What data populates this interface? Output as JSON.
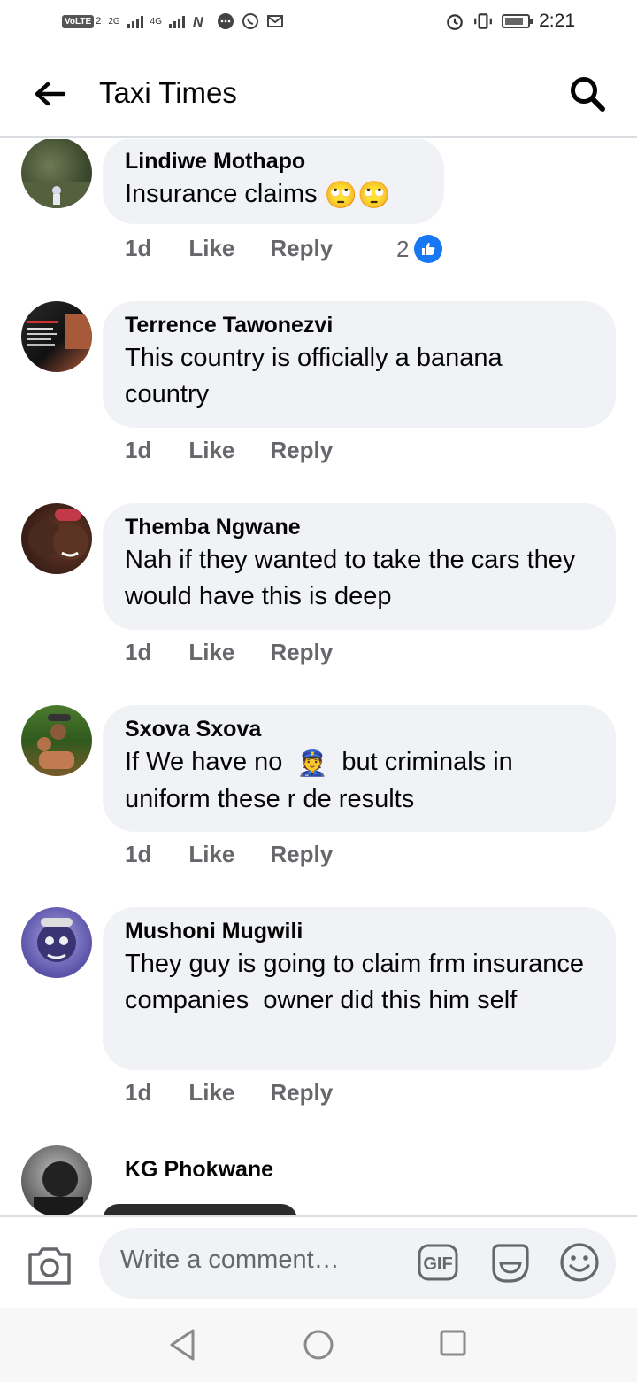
{
  "status_bar": {
    "network_badge": "VoLTE",
    "sim_index": "2",
    "signal1": "2G",
    "signal2": "4G",
    "time": "2:21"
  },
  "header": {
    "title": "Taxi Times"
  },
  "comments": [
    {
      "name": "Lindiwe Mothapo",
      "text": "Insurance claims",
      "emojis": "🙄🙄",
      "time": "1d",
      "like": "Like",
      "reply": "Reply",
      "reaction_count": "2"
    },
    {
      "name": "Terrence Tawonezvi",
      "text": "This country is officially a banana country",
      "time": "1d",
      "like": "Like",
      "reply": "Reply"
    },
    {
      "name": "Themba Ngwane",
      "text": "Nah if they wanted to take the cars they would have this is deep",
      "time": "1d",
      "like": "Like",
      "reply": "Reply"
    },
    {
      "name": "Sxova Sxova",
      "text_before": "If We have no",
      "emoji": "👮",
      "text_after": "but criminals in uniform these r de results",
      "time": "1d",
      "like": "Like",
      "reply": "Reply"
    },
    {
      "name": "Mushoni Mugwili",
      "text": "They guy is going to claim frm insurance companies  owner did this him self",
      "time": "1d",
      "like": "Like",
      "reply": "Reply"
    },
    {
      "name": "KG Phokwane"
    }
  ],
  "composer": {
    "placeholder": "Write a comment…",
    "gif_label": "GIF"
  },
  "colors": {
    "accent": "#1877f2",
    "bubble": "#f0f2f5",
    "secondary_text": "#65676b"
  }
}
